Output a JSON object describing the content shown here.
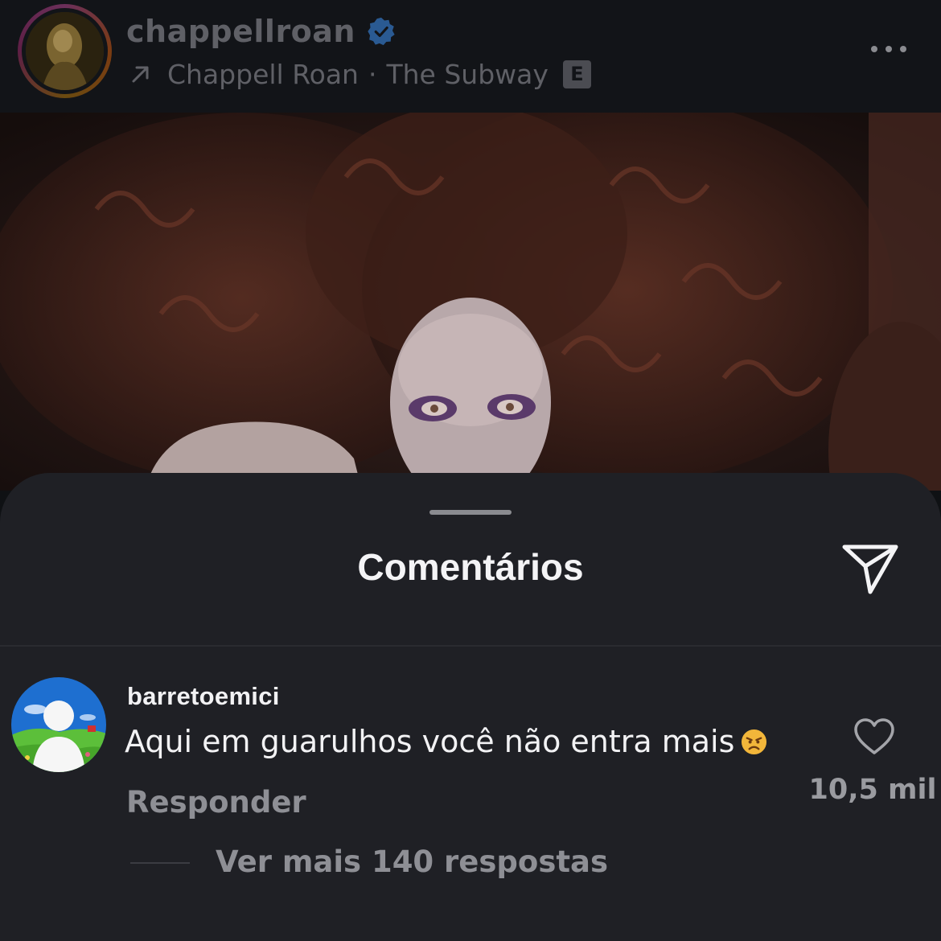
{
  "header": {
    "username": "chappellroan",
    "audio": {
      "artist": "Chappell Roan",
      "separator": "·",
      "track": "The Subway",
      "explicit_badge": "E"
    }
  },
  "sheet": {
    "title": "Comentários"
  },
  "comment": {
    "username": "barretoemici",
    "text": "Aqui em guarulhos você não entra mais",
    "emoji": "angry-face",
    "reply_label": "Responder",
    "like_count": "10,5 mil",
    "view_replies_label": "Ver mais 140 respostas"
  },
  "colors": {
    "header_bg": "#121418",
    "sheet_bg": "#1f2025",
    "verified_blue": "#3797f0",
    "text_primary": "#f2f2f4",
    "text_secondary": "#8e8f95",
    "header_text_dimmed": "#5f6066"
  },
  "icons": [
    "verified-badge-icon",
    "arrow-up-right-icon",
    "more-options-icon",
    "send-icon",
    "heart-icon"
  ]
}
